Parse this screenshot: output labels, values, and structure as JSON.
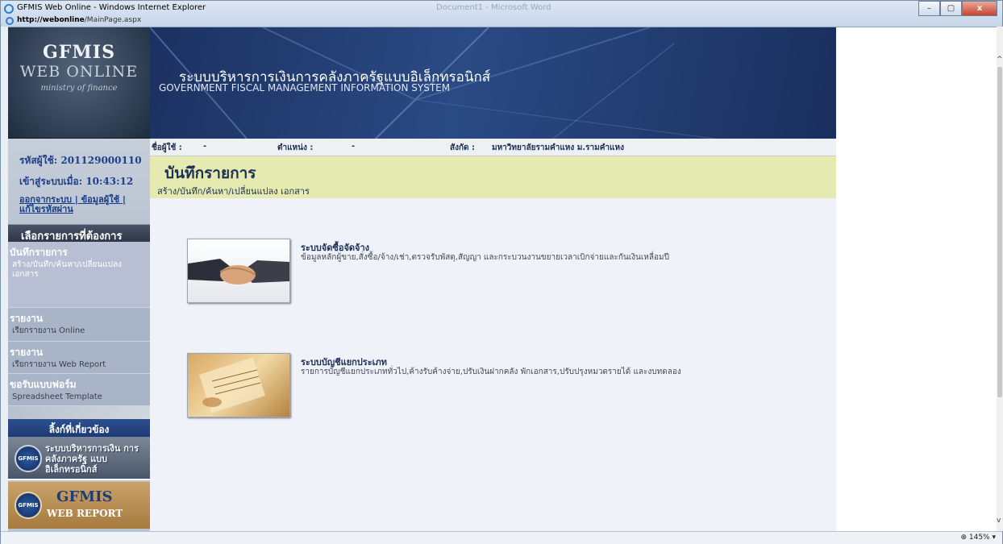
{
  "window": {
    "title": "GFMIS Web Online - Windows Internet Explorer",
    "background_title": "Document1 - Microsoft Word",
    "url_host": "http://webonline",
    "url_path": "/MainPage.aspx",
    "controls": [
      "–",
      "▢",
      "x"
    ],
    "zoom": "145%"
  },
  "logo": {
    "line1": "GFMIS",
    "line2": "WEB ONLINE",
    "line3": "ministry of finance"
  },
  "header": {
    "title_th": "ระบบบริหารการเงินการคลังภาครัฐแบบอิเล็กทรอนิกส์",
    "title_en": "GOVERNMENT FISCAL MANAGEMENT INFORMATION SYSTEM"
  },
  "info_bar": {
    "user_label": "ชื่อผู้ใช้ :",
    "user_value": "-",
    "position_label": "ตำแหน่ง :",
    "position_value": "-",
    "org_label": "สังกัด :",
    "org_value": "มหาวิทยาลัยรามคำแหง ม.รามคำแหง"
  },
  "user": {
    "id_label": "รหัสผู้ใช้:",
    "id_value": "201129000110",
    "login_label": "เข้าสู่ระบบเมื่อ:",
    "login_value": "10:43:12",
    "link_logout": "ออกจากระบบ",
    "link_profile": "ข้อมูลผู้ใช้",
    "link_password": "แก้ไขรหัสผ่าน",
    "sep": "|"
  },
  "menu": {
    "header": "เลือกรายการที่ต้องการ",
    "items": [
      {
        "title": "บันทึกรายการ",
        "sub": "สร้าง/บันทึก/ค้นหา/เปลี่ยนแปลง เอกสาร"
      },
      {
        "title": "รายงาน",
        "sub": "เรียกรายงาน Online"
      },
      {
        "title": "รายงาน",
        "sub": "เรียกรายงาน Web Report"
      },
      {
        "title": "ขอรับแบบฟอร์ม",
        "sub": "Spreadsheet Template"
      }
    ]
  },
  "related": {
    "header": "ลิ้งก์ที่เกี่ยวข้อง",
    "banner1_logo": "GFMIS",
    "banner1_text": "ระบบบริหารการเงิน การคลังภาครัฐ แบบอิเล็กทรอนิกส์",
    "banner2_logo": "GFMIS",
    "banner2_line1": "GFMIS",
    "banner2_line2": "WEB REPORT"
  },
  "page": {
    "title": "บันทึกรายการ",
    "subtitle": "สร้าง/บันทึก/ค้นหา/เปลี่ยนแปลง เอกสาร"
  },
  "modules": [
    {
      "title": "ระบบจัดซื้อจัดจ้าง",
      "desc": "ข้อมูลหลักผู้ขาย,สั่งซื้อ/จ้าง/เช่า,ตรวจรับพัสดุ,สัญญา และกระบวนงานขยายเวลาเบิกจ่ายและกันเงินเหลื่อมปี",
      "icon": "handshake-icon"
    },
    {
      "title": "ระบบบัญชีแยกประเภท",
      "desc": "รายการบัญชีแยกประเภททั่วไป,ค้างรับค้างจ่าย,ปรับเงินฝากคลัง พักเอกสาร,ปรับปรุงหมวดรายได้ และงบทดลอง",
      "icon": "ledger-icon"
    }
  ]
}
